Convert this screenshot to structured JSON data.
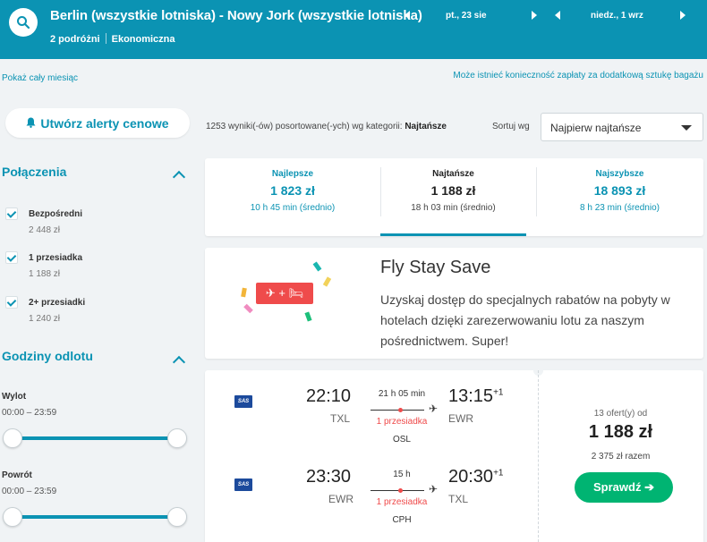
{
  "header": {
    "route": "Berlin (wszystkie lotniska) - Nowy Jork (wszystkie lotniska)",
    "travelers": "2 podróżni",
    "cabin": "Ekonomiczna",
    "depart_date": "pt., 23 sie",
    "return_date": "niedz., 1 wrz"
  },
  "links": {
    "month": "Pokaż cały miesiąc",
    "bag": "Może istnieć konieczność zapłaty za dodatkową sztukę bagażu"
  },
  "sidebar": {
    "alert_label": "Utwórz alerty cenowe",
    "connections_title": "Połączenia",
    "connections": [
      {
        "label": "Bezpośredni",
        "price": "2 448 zł",
        "checked": true
      },
      {
        "label": "1 przesiadka",
        "price": "1 188 zł",
        "checked": true
      },
      {
        "label": "2+ przesiadki",
        "price": "1 240 zł",
        "checked": true
      }
    ],
    "times_title": "Godziny odlotu",
    "departure": {
      "label": "Wylot",
      "range": "00:00 – 23:59"
    },
    "return": {
      "label": "Powrót",
      "range": "00:00 – 23:59"
    }
  },
  "results": {
    "count_text": "1253 wyniki(-ów) posortowane(-ych) wg kategorii:",
    "sort_category": "Najtańsze",
    "sort_label": "Sortuj wg",
    "sort_value": "Najpierw najtańsze"
  },
  "tabs": [
    {
      "name": "Najlepsze",
      "price": "1 823 zł",
      "time": "10 h 45 min (średnio)"
    },
    {
      "name": "Najtańsze",
      "price": "1 188 zł",
      "time": "18 h 03 min (średnio)"
    },
    {
      "name": "Najszybsze",
      "price": "18 893 zł",
      "time": "8 h 23 min (średnio)"
    }
  ],
  "promo": {
    "badge": "✈ + 🛏",
    "title": "Fly Stay Save",
    "text": "Uzyskaj dostęp do specjalnych rabatów na pobyty w hotelach dzięki zarezerwowaniu lotu za naszym pośrednictwem. Super!"
  },
  "flight": {
    "airline": "SAS",
    "outbound": {
      "dep_time": "22:10",
      "dep_code": "TXL",
      "duration": "21 h 05 min",
      "stops": "1 przesiadka",
      "stop_code": "OSL",
      "arr_time": "13:15",
      "arr_offset": "+1",
      "arr_code": "EWR"
    },
    "inbound": {
      "dep_time": "23:30",
      "dep_code": "EWR",
      "duration": "15 h",
      "stops": "1 przesiadka",
      "stop_code": "CPH",
      "arr_time": "20:30",
      "arr_offset": "+1",
      "arr_code": "TXL"
    },
    "offers_count": "13 ofert(y) od",
    "price": "1 188 zł",
    "total": "2 375 zł razem",
    "cta": "Sprawdź ➔"
  },
  "colors": {
    "brand": "#0b93b3",
    "cta": "#00b472",
    "stop": "#ef4b4b"
  }
}
